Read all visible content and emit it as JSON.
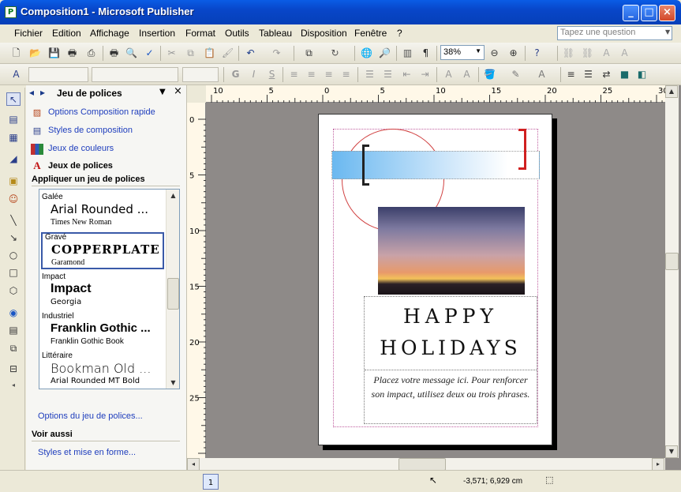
{
  "window": {
    "title": "Composition1 - Microsoft Publisher"
  },
  "menu": {
    "items": [
      "Fichier",
      "Edition",
      "Affichage",
      "Insertion",
      "Format",
      "Outils",
      "Tableau",
      "Disposition",
      "Fenêtre",
      "?"
    ],
    "help_placeholder": "Tapez une question"
  },
  "toolbar": {
    "zoom": "38%"
  },
  "taskpane": {
    "title": "Jeu de polices",
    "links": [
      "Options Composition rapide",
      "Styles de composition",
      "Jeux de couleurs",
      "Jeux de polices"
    ],
    "section": "Appliquer un jeu de polices",
    "font_schemes": [
      {
        "category": "Galée",
        "major": "Arial Rounded ...",
        "minor": "Times New Roman"
      },
      {
        "category": "Gravé",
        "major": "COPPERPLATE ...",
        "minor": "Garamond"
      },
      {
        "category": "Impact",
        "major": "Impact",
        "minor": "Georgia"
      },
      {
        "category": "Industriel",
        "major": "Franklin Gothic ...",
        "minor": "Franklin Gothic Book"
      },
      {
        "category": "Littéraire",
        "major": "Bookman Old ...",
        "minor": "Arial Rounded MT Bold"
      }
    ],
    "options_link": "Options du jeu de polices...",
    "see_also": "Voir aussi",
    "styles_link": "Styles et mise en forme..."
  },
  "rulers": {
    "h_ticks": [
      "10",
      "5",
      "0",
      "5",
      "10",
      "15",
      "20",
      "25",
      "30"
    ],
    "v_ticks": [
      "0",
      "5",
      "10",
      "15",
      "20",
      "25"
    ]
  },
  "document": {
    "heading_line1": "Happy",
    "heading_line2": "Holidays",
    "message": "Placez votre message ici. Pour renforcer son impact, utilisez deux ou trois phrases."
  },
  "status": {
    "page": "1",
    "coords": "-3,571; 6,929 cm"
  },
  "colors": {
    "titlebar": "#0846c9",
    "link": "#1f3ebd",
    "workspace": "#8e8a88"
  }
}
